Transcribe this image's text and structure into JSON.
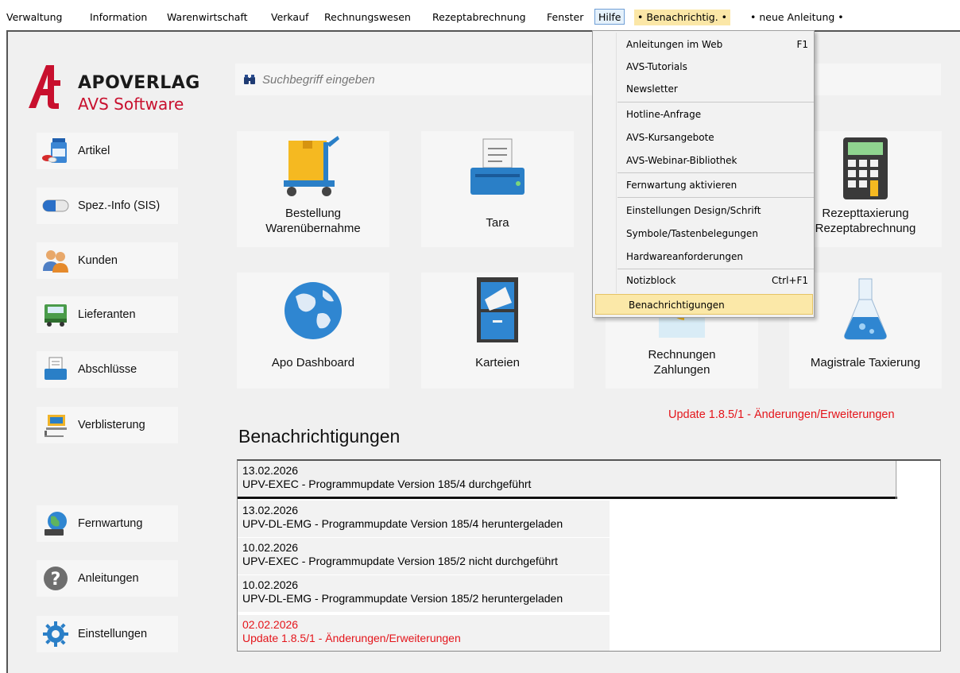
{
  "menubar": {
    "items": [
      "Verwaltung",
      "Information",
      "Warenwirtschaft",
      "Verkauf",
      "Rechnungswesen",
      "Rezeptabrechnung",
      "Fenster",
      "Hilfe",
      "• Benachrichtig. •",
      "• neue Anleitung •"
    ]
  },
  "logo": {
    "name": "APOVERLAG",
    "sub": "AVS Software"
  },
  "search": {
    "placeholder": "Suchbegriff eingeben"
  },
  "sidebar": {
    "items": [
      "Artikel",
      "Spez.-Info (SIS)",
      "Kunden",
      "Lieferanten",
      "Abschlüsse",
      "Verblisterung",
      "Fernwartung",
      "Anleitungen",
      "Einstellungen"
    ]
  },
  "tiles": [
    "Bestellung\nWarenübernahme",
    "Tara",
    "Rezepttaxierung\nRezeptabrechnung",
    "Apo Dashboard",
    "Karteien",
    "Rechnungen\nZahlungen",
    "Magistrale Taxierung"
  ],
  "notifications": {
    "title": "Benachrichtigungen",
    "update_link": "Update 1.8.5/1 - Änderungen/Erweiterungen",
    "items": [
      {
        "date": "13.02.2026",
        "text": "UPV-EXEC - Programmupdate Version 185/4 durchgeführt"
      },
      {
        "date": "13.02.2026",
        "text": "UPV-DL-EMG - Programmupdate Version 185/4 heruntergeladen"
      },
      {
        "date": "10.02.2026",
        "text": "UPV-EXEC - Programmupdate Version 185/2 nicht durchgeführt"
      },
      {
        "date": "10.02.2026",
        "text": "UPV-DL-EMG - Programmupdate Version 185/2 heruntergeladen"
      },
      {
        "date": "02.02.2026",
        "text": "Update 1.8.5/1 - Änderungen/Erweiterungen"
      }
    ]
  },
  "help_menu": {
    "items": [
      {
        "label": "Anleitungen im Web",
        "shortcut": "F1"
      },
      {
        "label": "AVS-Tutorials"
      },
      {
        "label": "Newsletter"
      },
      {
        "label": "Hotline-Anfrage"
      },
      {
        "label": "AVS-Kursangebote"
      },
      {
        "label": "AVS-Webinar-Bibliothek"
      },
      {
        "label": "Fernwartung aktivieren"
      },
      {
        "label": "Einstellungen Design/Schrift"
      },
      {
        "label": "Symbole/Tastenbelegungen"
      },
      {
        "label": "Hardwareanforderungen"
      },
      {
        "label": "Notizblock",
        "shortcut": "Ctrl+F1"
      },
      {
        "label": "Benachrichtigungen"
      }
    ]
  },
  "colors": {
    "brand_red": "#c8102e",
    "alert_red": "#e4151b",
    "highlight": "#fbe8a8"
  }
}
